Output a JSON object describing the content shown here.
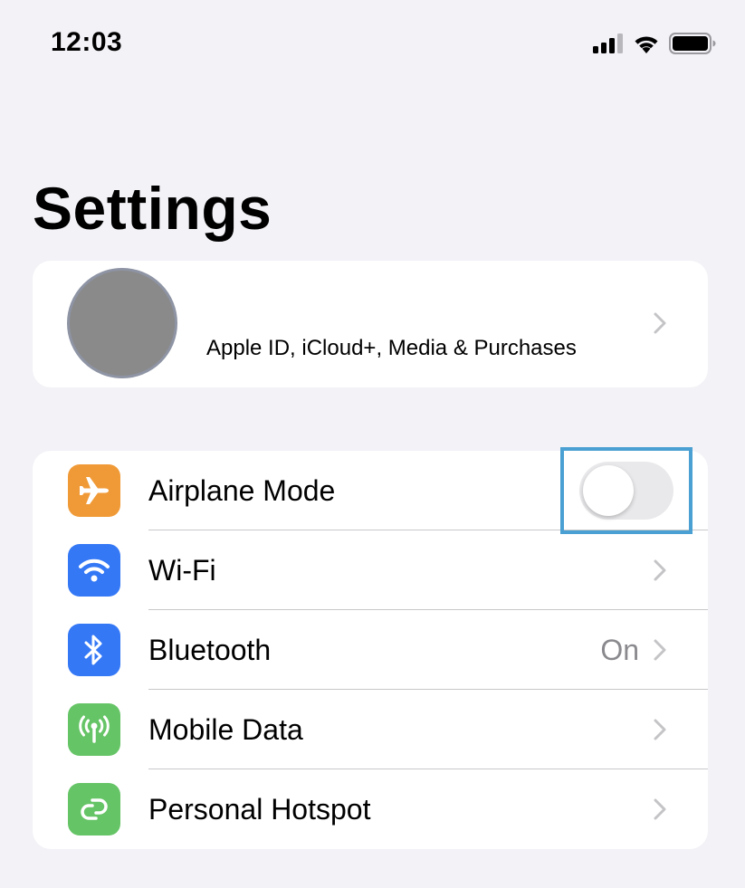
{
  "status_bar": {
    "time": "12:03",
    "icons": [
      "cellular-signal-icon",
      "wifi-icon",
      "battery-icon"
    ]
  },
  "page": {
    "title": "Settings"
  },
  "profile": {
    "subtitle": "Apple ID, iCloud+, Media & Purchases"
  },
  "settings": {
    "rows": [
      {
        "label": "Airplane Mode",
        "icon": "airplane-icon",
        "icon_color": "#f09a37",
        "control": "toggle",
        "toggle_on": false
      },
      {
        "label": "Wi-Fi",
        "icon": "wifi-icon",
        "icon_color": "#3478f6",
        "control": "chevron"
      },
      {
        "label": "Bluetooth",
        "icon": "bluetooth-icon",
        "icon_color": "#3478f6",
        "control": "chevron",
        "value": "On"
      },
      {
        "label": "Mobile Data",
        "icon": "antenna-icon",
        "icon_color": "#65c466",
        "control": "chevron"
      },
      {
        "label": "Personal Hotspot",
        "icon": "hotspot-icon",
        "icon_color": "#65c466",
        "control": "chevron"
      }
    ]
  },
  "colors": {
    "background": "#f2f2f7",
    "highlight": "#4aa0d2",
    "separator": "#c8c8cc"
  }
}
